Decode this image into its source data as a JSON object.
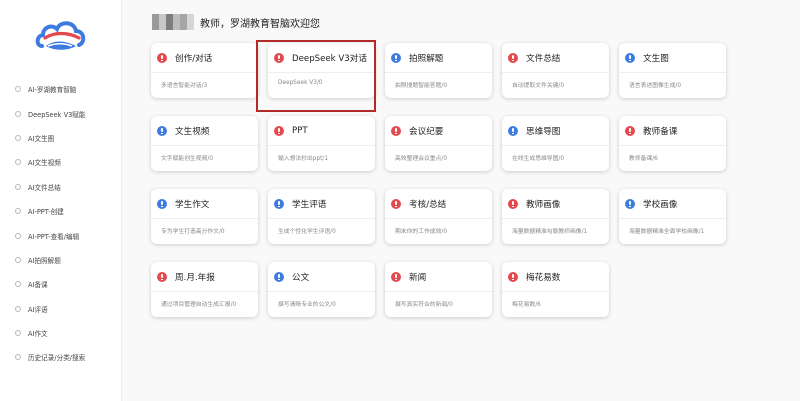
{
  "sidebar": {
    "items": [
      {
        "label": "AI-罗湖教育智脑"
      },
      {
        "label": "DeepSeek V3赋能"
      },
      {
        "label": "AI文生图"
      },
      {
        "label": "AI文生视频"
      },
      {
        "label": "AI文件总结"
      },
      {
        "label": "AI-PPT-创建"
      },
      {
        "label": "AI-PPT-查看/编辑"
      },
      {
        "label": "AI拍照解题"
      },
      {
        "label": "AI备课"
      },
      {
        "label": "AI评语"
      },
      {
        "label": "AI作文"
      },
      {
        "label": "历史记录/分类/搜索"
      }
    ]
  },
  "header": {
    "welcome": "教师，罗湖教育智脑欢迎您"
  },
  "colors": {
    "red": "#e5484d",
    "blue": "#3d7be0",
    "highlight": "#b22a2a"
  },
  "cards": [
    {
      "title": "创作/对话",
      "desc": "多语言智能对话/3",
      "color": "red"
    },
    {
      "title": "DeepSeek V3对话",
      "desc": "DeepSeek V3/0",
      "color": "red"
    },
    {
      "title": "拍照解题",
      "desc": "拍照搜题智能答题/0",
      "color": "blue"
    },
    {
      "title": "文件总结",
      "desc": "自动提取文件关键/0",
      "color": "red"
    },
    {
      "title": "文生图",
      "desc": "语言表述图像生成/0",
      "color": "blue"
    },
    {
      "title": "文生视频",
      "desc": "文字赋能创生视频/0",
      "color": "blue"
    },
    {
      "title": "PPT",
      "desc": "输入想法秒出ppt/1",
      "color": "red"
    },
    {
      "title": "会议纪要",
      "desc": "高效整理会议重点/0",
      "color": "red"
    },
    {
      "title": "思维导图",
      "desc": "在线生成思维导图/0",
      "color": "blue"
    },
    {
      "title": "教师备课",
      "desc": "教师备课/6",
      "color": "red"
    },
    {
      "title": "学生作文",
      "desc": "专为学生打造高分作文/0",
      "color": "blue"
    },
    {
      "title": "学生评语",
      "desc": "生成个性化学生评语/0",
      "color": "blue"
    },
    {
      "title": "考核/总结",
      "desc": "期末你的工作成效/0",
      "color": "red"
    },
    {
      "title": "教师画像",
      "desc": "海量数据精准勾勒教师画像/1",
      "color": "red"
    },
    {
      "title": "学校画像",
      "desc": "海量数据精准全面学校画像/1",
      "color": "blue"
    },
    {
      "title": "周.月.年报",
      "desc": "通过项目管理自动生成汇报/0",
      "color": "red"
    },
    {
      "title": "公文",
      "desc": "撰写清晰专业的公文/0",
      "color": "blue"
    },
    {
      "title": "新闻",
      "desc": "撰写真实符合的新闻/0",
      "color": "red"
    },
    {
      "title": "梅花易数",
      "desc": "梅花易数/6",
      "color": "red"
    }
  ]
}
